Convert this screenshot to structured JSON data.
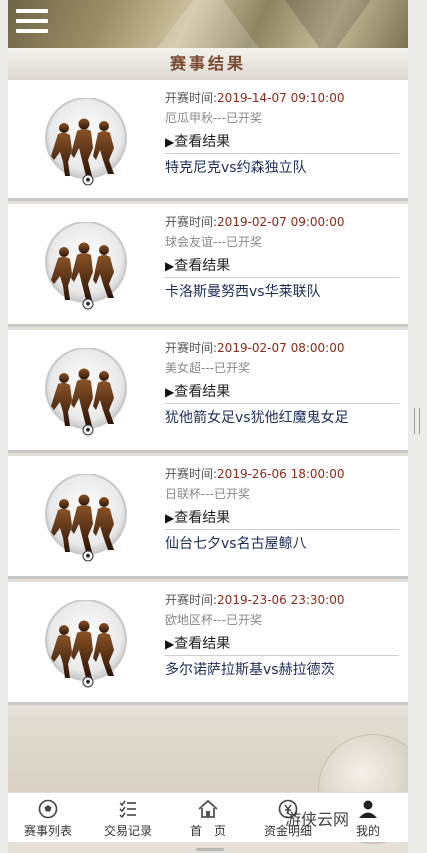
{
  "header": {
    "menu_icon": "hamburger-menu-icon",
    "title": "赛事结果"
  },
  "results": [
    {
      "time_label": "开赛时间:",
      "time_value": "2019-14-07 09:10:00",
      "league": "厄瓜甲秋---已开奖",
      "view_label": "查看结果",
      "match": "特克尼克vs约森独立队"
    },
    {
      "time_label": "开赛时间:",
      "time_value": "2019-02-07 09:00:00",
      "league": "球会友谊---已开奖",
      "view_label": "查看结果",
      "match": "卡洛斯曼努西vs华莱联队"
    },
    {
      "time_label": "开赛时间:",
      "time_value": "2019-02-07 08:00:00",
      "league": "美女超---已开奖",
      "view_label": "查看结果",
      "match": "犹他箭女足vs犹他红魔鬼女足"
    },
    {
      "time_label": "开赛时间:",
      "time_value": "2019-26-06 18:00:00",
      "league": "日联杯---已开奖",
      "view_label": "查看结果",
      "match": "仙台七夕vs名古屋鲸八"
    },
    {
      "time_label": "开赛时间:",
      "time_value": "2019-23-06 23:30:00",
      "league": "欧地区杯---已开奖",
      "view_label": "查看结果",
      "match": "多尔诺萨拉斯基vs赫拉德茨"
    }
  ],
  "tabs": [
    {
      "label": "赛事列表",
      "icon": "soccer-ball-icon"
    },
    {
      "label": "交易记录",
      "icon": "checklist-icon"
    },
    {
      "label": "首　页",
      "icon": "home-icon"
    },
    {
      "label": "资金明细",
      "icon": "money-icon"
    },
    {
      "label": "我的",
      "icon": "user-icon"
    }
  ],
  "watermark": "游侠云网",
  "colors": {
    "title": "#7a4a32",
    "time_value": "#8b2a1a",
    "match": "#1c2d57"
  }
}
